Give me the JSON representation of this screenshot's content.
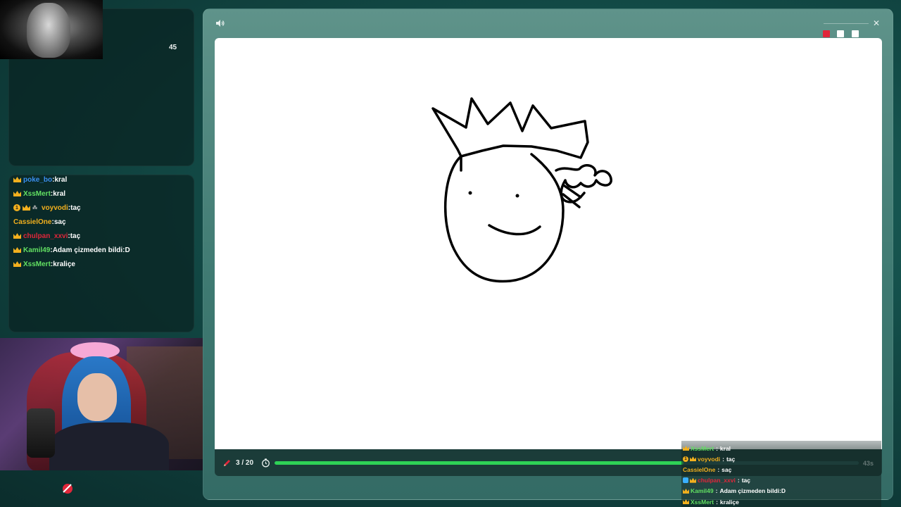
{
  "stream": {
    "viewer_count": "45"
  },
  "left_chat": {
    "messages": [
      {
        "user": "poke_bo",
        "color": "#3a8ff0",
        "badges": [
          "crown"
        ],
        "text": "kral",
        "cut": true
      },
      {
        "user": "XssMert",
        "color": "#62e062",
        "badges": [
          "crown"
        ],
        "text": "kral"
      },
      {
        "user": "voyvodi",
        "color": "#f2b01e",
        "badges": [
          "one",
          "crown",
          "tiny"
        ],
        "text": "taç"
      },
      {
        "user": "CassielOne",
        "color": "#f2b01e",
        "badges": [],
        "text": "saç"
      },
      {
        "user": "chulpan_xxvi",
        "color": "#e0263a",
        "badges": [
          "crown"
        ],
        "text": "taç"
      },
      {
        "user": "Kamil49",
        "color": "#62e062",
        "badges": [
          "crown"
        ],
        "text": "Adam çizmeden bildi:D"
      },
      {
        "user": "XssMert",
        "color": "#62e062",
        "badges": [
          "crown"
        ],
        "text": "kraliçe"
      }
    ]
  },
  "game": {
    "round_counter": "3 / 20",
    "progress_percent": 70,
    "timer_text": "43s",
    "close_label": "✕",
    "colors": {
      "accent_green": "#2ed256",
      "swatches": [
        "#e0263a",
        "#ffffff",
        "#ffffff"
      ]
    }
  },
  "overlay_chat": {
    "messages": [
      {
        "user": "XssMert",
        "color": "#62e062",
        "badges": [
          "crown"
        ],
        "text": "kral"
      },
      {
        "user": "voyvodi",
        "color": "#f2b01e",
        "badges": [
          "one",
          "crown"
        ],
        "text": "taç"
      },
      {
        "user": "CassielOne",
        "color": "#f2b01e",
        "badges": [],
        "text": "saç"
      },
      {
        "user": "chulpan_xxvi",
        "color": "#e0263a",
        "badges": [
          "blue",
          "crown"
        ],
        "text": "taç"
      },
      {
        "user": "Kamil49",
        "color": "#62e062",
        "badges": [
          "crown"
        ],
        "text": "Adam çizmeden bildi:D"
      },
      {
        "user": "XssMert",
        "color": "#62e062",
        "badges": [
          "crown"
        ],
        "text": "kraliçe"
      }
    ]
  },
  "icons": {
    "sound": "speaker-icon",
    "close": "close-icon",
    "pencil": "pencil-icon",
    "timer": "timer-icon",
    "crown": "crown-badge-icon",
    "logo": "brand-logo-icon"
  }
}
